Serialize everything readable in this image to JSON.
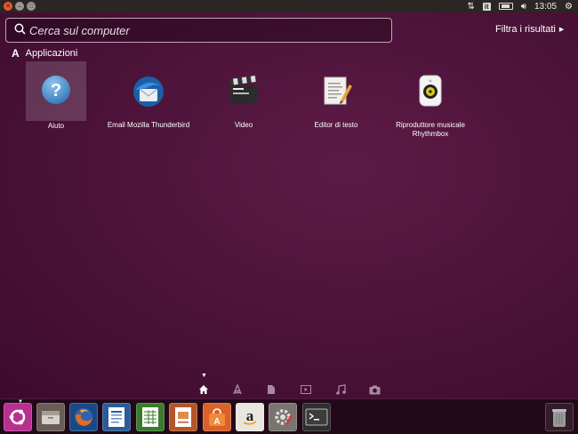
{
  "topbar": {
    "keyboard_layout": "it",
    "clock": "13:05"
  },
  "search": {
    "placeholder": "Cerca sul computer",
    "filter_label": "Filtra i risultati"
  },
  "section": {
    "title": "Applicazioni"
  },
  "apps": [
    {
      "label": "Aiuto",
      "icon": "help-icon",
      "selected": true
    },
    {
      "label": "Email Mozilla Thunderbird",
      "icon": "thunderbird-icon"
    },
    {
      "label": "Video",
      "icon": "video-clapper-icon"
    },
    {
      "label": "Editor di testo",
      "icon": "text-editor-icon"
    },
    {
      "label": "Riproduttore musicale Rhythmbox",
      "icon": "rhythmbox-speaker-icon"
    }
  ],
  "scopes": [
    "home-scope-icon",
    "applications-scope-icon",
    "files-scope-icon",
    "video-scope-icon",
    "music-scope-icon",
    "photos-scope-icon"
  ],
  "launcher": [
    "ubuntu-dash-icon",
    "files-icon",
    "firefox-icon",
    "writer-icon",
    "calc-icon",
    "impress-icon",
    "software-center-icon",
    "amazon-icon",
    "system-settings-icon",
    "terminal-icon",
    "trash-icon"
  ],
  "colors": {
    "background": "#4b1238",
    "panel": "#2b2624",
    "close": "#e8582e"
  }
}
